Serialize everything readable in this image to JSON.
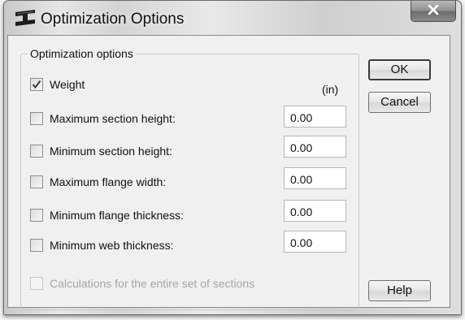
{
  "window": {
    "title": "Optimization Options",
    "icon": "beam-section-icon"
  },
  "group": {
    "legend": "Optimization options",
    "units_label": "(in)"
  },
  "options": [
    {
      "label": "Weight",
      "checked": true,
      "has_value": false
    },
    {
      "label": "Maximum section height:",
      "checked": false,
      "value": "0.00"
    },
    {
      "label": "Minimum section height:",
      "checked": false,
      "value": "0.00"
    },
    {
      "label": "Maximum flange width:",
      "checked": false,
      "value": "0.00"
    },
    {
      "label": "Minimum flange thickness:",
      "checked": false,
      "value": "0.00"
    },
    {
      "label": "Minimum web thickness:",
      "checked": false,
      "value": "0.00"
    }
  ],
  "entire_set": {
    "label": "Calculations for the entire set of sections",
    "checked": false,
    "enabled": false
  },
  "buttons": {
    "ok": "OK",
    "cancel": "Cancel",
    "help": "Help"
  }
}
